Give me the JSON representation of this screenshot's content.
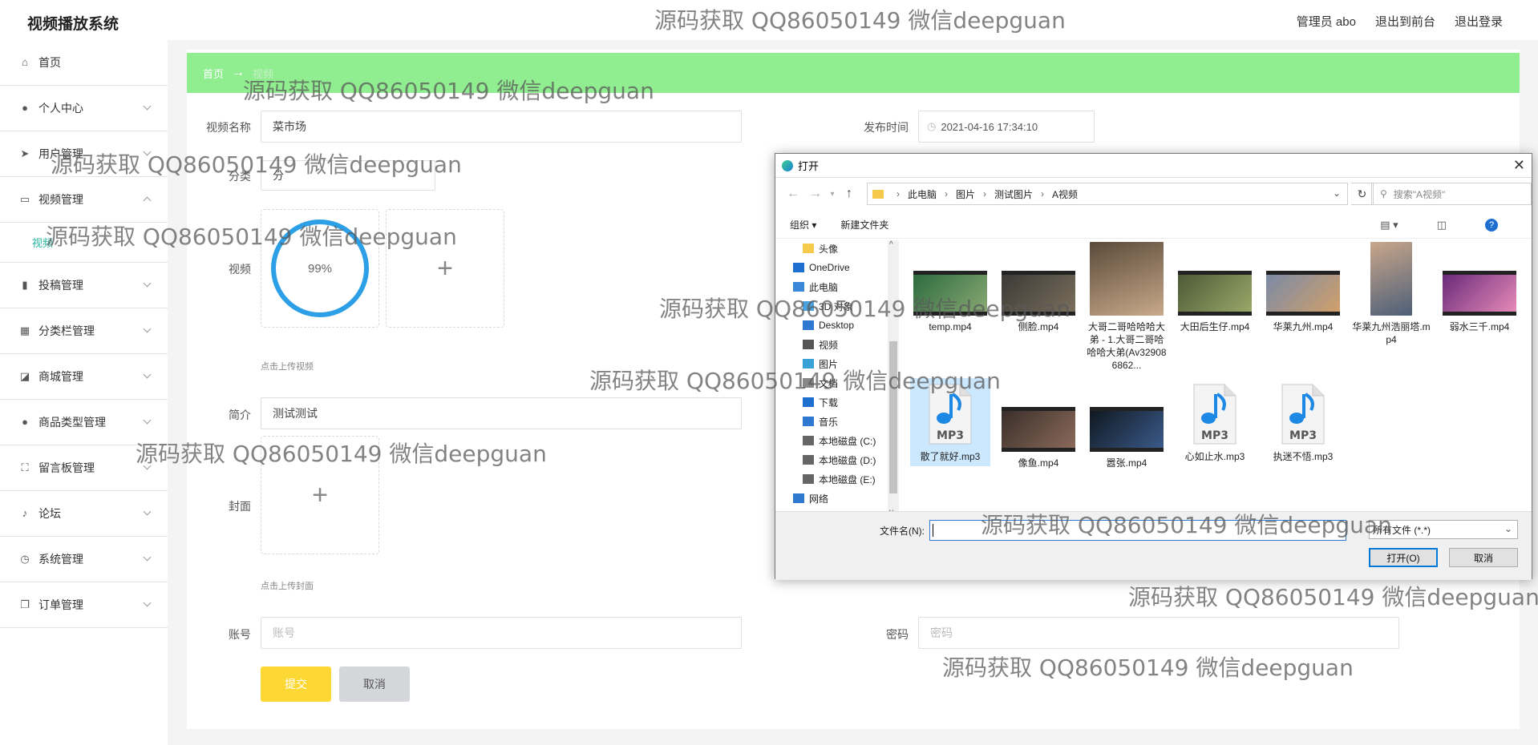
{
  "app": {
    "title": "视频播放系统"
  },
  "topnav": {
    "user": "管理员 abo",
    "front": "退出到前台",
    "logout": "退出登录"
  },
  "sidebar": {
    "items": [
      {
        "label": "首页"
      },
      {
        "label": "个人中心"
      },
      {
        "label": "用户管理"
      },
      {
        "label": "视频管理"
      },
      {
        "label": "投稿管理"
      },
      {
        "label": "分类栏管理"
      },
      {
        "label": "商城管理"
      },
      {
        "label": "商品类型管理"
      },
      {
        "label": "留言板管理"
      },
      {
        "label": "论坛"
      },
      {
        "label": "系统管理"
      },
      {
        "label": "订单管理"
      }
    ],
    "sub": "视频"
  },
  "breadcrumb": {
    "home": "首页",
    "arrow": "→",
    "current": "视频"
  },
  "form": {
    "name_label": "视频名称",
    "name_value": "菜市场",
    "time_label": "发布时间",
    "time_value": "2021-04-16 17:34:10",
    "cat_label": "分类",
    "cat_value": "分",
    "video_label": "视频",
    "progress": "99%",
    "video_tip": "点击上传视频",
    "intro_label": "简介",
    "intro_value": "测试测试",
    "cover_label": "封面",
    "cover_tip": "点击上传封面",
    "account_label": "账号",
    "account_placeholder": "账号",
    "pwd_label": "密码",
    "pwd_placeholder": "密码",
    "submit": "提交",
    "cancel": "取消"
  },
  "dialog": {
    "title": "打开",
    "path": [
      "此电脑",
      "图片",
      "测试图片",
      "A视频"
    ],
    "search_placeholder": "搜索\"A视频\"",
    "organize": "组织 ▾",
    "new_folder": "新建文件夹",
    "tree": [
      "头像",
      "OneDrive",
      "此电脑",
      "3D 对象",
      "Desktop",
      "视频",
      "图片",
      "文档",
      "下载",
      "音乐",
      "本地磁盘 (C:)",
      "本地磁盘 (D:)",
      "本地磁盘 (E:)",
      "网络"
    ],
    "files": [
      {
        "name": "temp.mp4",
        "kind": "video"
      },
      {
        "name": "侧脸.mp4",
        "kind": "video"
      },
      {
        "name": "大哥二哥哈哈哈大弟 - 1.大哥二哥哈哈哈大弟(Av329086862...",
        "kind": "video"
      },
      {
        "name": "大田后生仔.mp4",
        "kind": "video"
      },
      {
        "name": "华莱九州.mp4",
        "kind": "video"
      },
      {
        "name": "华莱九州浩丽塔.mp4",
        "kind": "video"
      },
      {
        "name": "弱水三千.mp4",
        "kind": "video"
      },
      {
        "name": "散了就好.mp3",
        "kind": "audio"
      },
      {
        "name": "像鱼.mp4",
        "kind": "video"
      },
      {
        "name": "嚣张.mp4",
        "kind": "video"
      },
      {
        "name": "心如止水.mp3",
        "kind": "audio"
      },
      {
        "name": "执迷不悟.mp3",
        "kind": "audio"
      }
    ],
    "filename_label": "文件名(N):",
    "filetype": "所有文件 (*.*)",
    "open": "打开(O)",
    "cancel": "取消",
    "mp3_label": "MP3"
  },
  "watermark": "源码获取 QQ86050149 微信deepguan",
  "colors": {
    "accent": "#26b5a0",
    "breadcrumb_bg": "#90ee90",
    "submit": "#fdd835",
    "progress": "#2d9fe6"
  }
}
